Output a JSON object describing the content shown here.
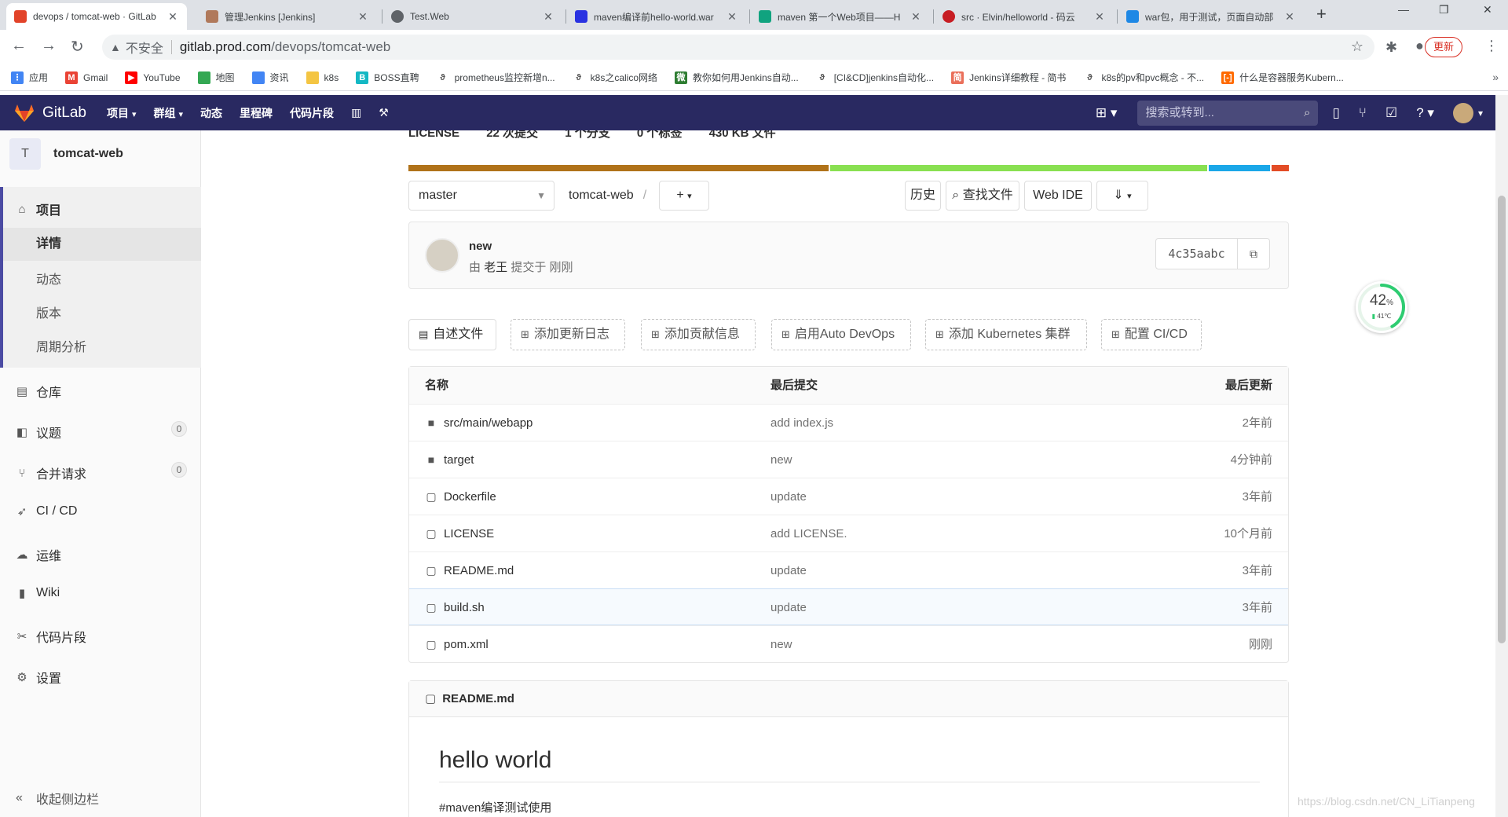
{
  "browser": {
    "tabs": [
      {
        "title": "devops / tomcat-web · GitLab",
        "icon": "gitlab-icon",
        "color": "#e24329"
      },
      {
        "title": "管理Jenkins [Jenkins]",
        "icon": "jenkins-icon",
        "color": "#b0795b"
      },
      {
        "title": "Test.Web",
        "icon": "globe-icon",
        "color": "#5f6368"
      },
      {
        "title": "maven编译前hello-world.war",
        "icon": "baidu-icon",
        "color": "#2932e1"
      },
      {
        "title": "maven 第一个Web项目——H",
        "icon": "chatgpt-icon",
        "color": "#10a37f"
      },
      {
        "title": "src · Elvin/helloworld - 码云",
        "icon": "gitee-icon",
        "color": "#c71d23"
      },
      {
        "title": "war包，用于测试，页面自动部",
        "icon": "csdn-icon",
        "color": "#1e88e5"
      }
    ],
    "address": {
      "insecure_label": "不安全",
      "host": "gitlab.prod.com",
      "path": "/devops/tomcat-web"
    },
    "update_label": "更新",
    "bookmarks": [
      {
        "label": "应用",
        "color": "#4285f4"
      },
      {
        "label": "Gmail",
        "color": "#ea4335"
      },
      {
        "label": "YouTube",
        "color": "#ff0000"
      },
      {
        "label": "地图",
        "color": "#34a853"
      },
      {
        "label": "资讯",
        "color": "#4285f4"
      },
      {
        "label": "k8s",
        "color": "#f4c542"
      },
      {
        "label": "BOSS直聘",
        "color": "#14b8c4"
      },
      {
        "label": "prometheus监控新增n...",
        "color": "#555555"
      },
      {
        "label": "k8s之calico网络",
        "color": "#555555"
      },
      {
        "label": "教你如何用Jenkins自动...",
        "color": "#2e7d32"
      },
      {
        "label": "[CI&CD]jenkins自动化...",
        "color": "#555555"
      },
      {
        "label": "Jenkins详细教程 - 简书",
        "color": "#ea6f5a"
      },
      {
        "label": "k8s的pv和pvc概念 - 不...",
        "color": "#555555"
      },
      {
        "label": "什么是容器服务Kubern...",
        "color": "#ff6a00"
      }
    ]
  },
  "gitlab": {
    "brand": "GitLab",
    "nav": [
      "项目",
      "群组",
      "动态",
      "里程碑",
      "代码片段"
    ],
    "search_placeholder": "搜索或转到...",
    "colors": {
      "header": "#292961",
      "accent": "#4b4ba3"
    }
  },
  "sidebar": {
    "project_initial": "T",
    "project_name": "tomcat-web",
    "section_label": "项目",
    "sub_items": [
      "详情",
      "动态",
      "版本",
      "周期分析"
    ],
    "items": [
      {
        "label": "仓库",
        "icon": "document-icon"
      },
      {
        "label": "议题",
        "icon": "issues-icon",
        "badge": "0"
      },
      {
        "label": "合并请求",
        "icon": "merge-request-icon",
        "badge": "0"
      },
      {
        "label": "CI / CD",
        "icon": "rocket-icon"
      },
      {
        "label": "运维",
        "icon": "cloud-gear-icon"
      },
      {
        "label": "Wiki",
        "icon": "book-icon"
      },
      {
        "label": "代码片段",
        "icon": "scissors-icon"
      },
      {
        "label": "设置",
        "icon": "gear-icon"
      }
    ],
    "collapse_label": "收起侧边栏"
  },
  "repo": {
    "stats": [
      "LICENSE",
      "22 次提交",
      "1 个分支",
      "0 个标签",
      "430 KB 文件"
    ],
    "language_bar": [
      {
        "color": "#b07219",
        "share": 48
      },
      {
        "color": "#89e051",
        "share": 43
      },
      {
        "color": "#1aa7e8",
        "share": 7
      },
      {
        "color": "#e34c26",
        "share": 2
      }
    ],
    "branch": "master",
    "breadcrumb": "tomcat-web",
    "buttons": {
      "history": "历史",
      "find_file": "查找文件",
      "web_ide": "Web IDE"
    },
    "last_commit": {
      "title": "new",
      "author": "老王",
      "committed_label": "提交于",
      "time": "刚刚",
      "sha": "4c35aabc"
    },
    "quick_actions": [
      "自述文件",
      "添加更新日志",
      "添加贡献信息",
      "启用Auto DevOps",
      "添加 Kubernetes 集群",
      "配置 CI/CD"
    ],
    "table_headers": {
      "name": "名称",
      "last_commit": "最后提交",
      "last_update": "最后更新"
    },
    "files": [
      {
        "name": "src/main/webapp",
        "type": "folder",
        "commit": "add index.js",
        "time": "2年前"
      },
      {
        "name": "target",
        "type": "folder",
        "commit": "new",
        "time": "4分钟前"
      },
      {
        "name": "Dockerfile",
        "type": "file",
        "commit": "update",
        "time": "3年前"
      },
      {
        "name": "LICENSE",
        "type": "file",
        "commit": "add LICENSE.",
        "time": "10个月前"
      },
      {
        "name": "README.md",
        "type": "file",
        "commit": "update",
        "time": "3年前"
      },
      {
        "name": "build.sh",
        "type": "file",
        "commit": "update",
        "time": "3年前"
      },
      {
        "name": "pom.xml",
        "type": "file",
        "commit": "new",
        "time": "刚刚"
      }
    ],
    "readme": {
      "filename": "README.md",
      "heading": "hello world",
      "body": "#maven编译测试使用"
    }
  },
  "overlay": {
    "cpu_percent": "42",
    "percent_sign": "%",
    "temp": "41℃",
    "load_fraction": 0.42
  },
  "watermark": "https://blog.csdn.net/CN_LiTianpeng"
}
